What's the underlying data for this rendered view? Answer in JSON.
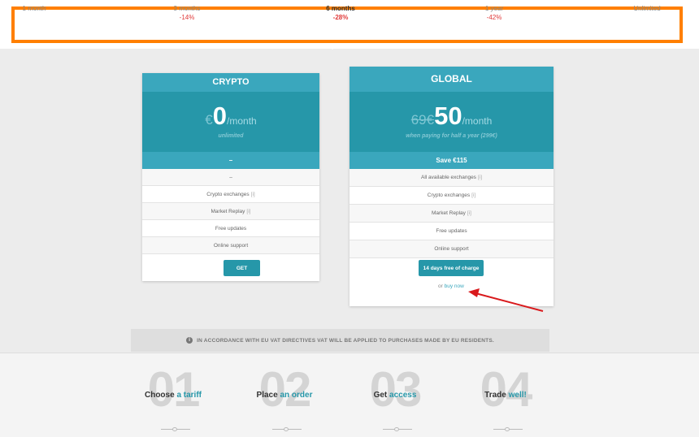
{
  "periods": [
    {
      "name": "1 month",
      "discount": ""
    },
    {
      "name": "3 months",
      "discount": "-14%"
    },
    {
      "name": "6 months",
      "discount": "-28%"
    },
    {
      "name": "1 year",
      "discount": "-42%"
    },
    {
      "name": "Unlimited",
      "discount": ""
    }
  ],
  "plans": [
    {
      "title": "CRYPTO",
      "currency": "€",
      "old_price": "",
      "amount": "0",
      "per": "/month",
      "note": "unlimited",
      "save": "–",
      "features": [
        "–",
        "Crypto exchanges",
        "Market Replay",
        "Free updates",
        "Online support"
      ],
      "feature_info": [
        "",
        "[i]",
        "[i]",
        "",
        ""
      ],
      "button": "GET"
    },
    {
      "title": "GLOBAL",
      "currency": "",
      "old_price": "69€",
      "amount": "50",
      "per": "/month",
      "note": "when paying for half a year (299€)",
      "save": "Save €115",
      "features": [
        "All available exchanges",
        "Crypto exchanges",
        "Market Replay",
        "Free updates",
        "Online support"
      ],
      "feature_info": [
        "[i]",
        "[i]",
        "[i]",
        "",
        ""
      ],
      "button": "14 days free of charge",
      "link_prefix": "or",
      "link": "buy now"
    }
  ],
  "notice": "IN ACCORDANCE WITH EU VAT DIRECTIVES VAT WILL BE APPLIED TO PURCHASES MADE BY EU RESIDENTS.",
  "steps": [
    {
      "num": "01",
      "word": "Choose",
      "accent": "a tariff"
    },
    {
      "num": "02",
      "word": "Place",
      "accent": "an order"
    },
    {
      "num": "03",
      "word": "Get",
      "accent": "access"
    },
    {
      "num": "04",
      "word": "Trade",
      "accent": "well!"
    }
  ],
  "colors": {
    "accent": "#2697a9",
    "header": "#3aa7bd",
    "highlight_frame": "#ff7f00",
    "discount": "#e03a3a",
    "annotation_arrow": "#d9191c"
  }
}
